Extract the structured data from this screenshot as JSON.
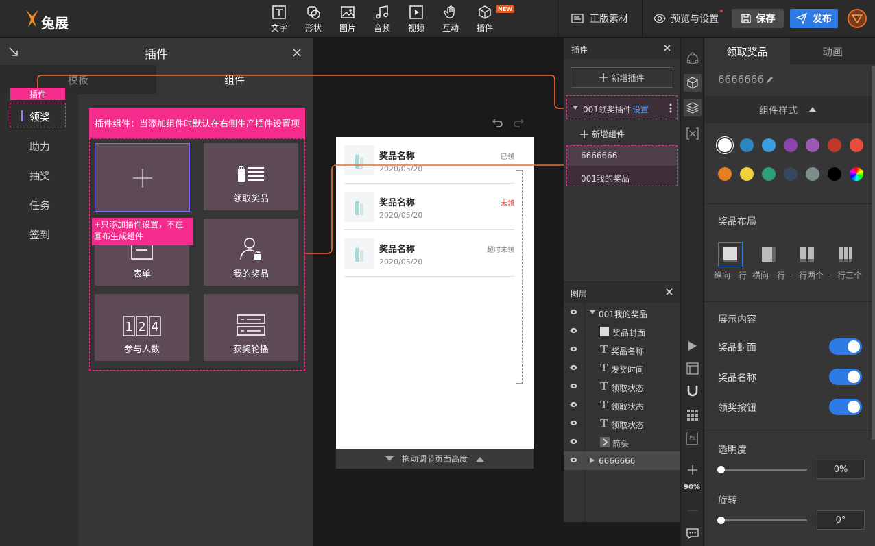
{
  "topbar": {
    "logo_text": "兔展",
    "tools": [
      {
        "label": "文字",
        "icon": "text-icon"
      },
      {
        "label": "形状",
        "icon": "shape-icon"
      },
      {
        "label": "图片",
        "icon": "image-icon"
      },
      {
        "label": "音频",
        "icon": "music-icon"
      },
      {
        "label": "视频",
        "icon": "video-icon"
      },
      {
        "label": "互动",
        "icon": "hand-icon"
      },
      {
        "label": "插件",
        "icon": "cube-icon"
      }
    ],
    "new_badge": "NEW",
    "assets_label": "正版素材",
    "preview_label": "预览与设置",
    "save_label": "保存",
    "publish_label": "发布"
  },
  "plugin_panel": {
    "title": "插件",
    "tabs": [
      "模板",
      "组件"
    ],
    "active_tab": "组件",
    "categories": [
      "领奖",
      "助力",
      "抽奖",
      "任务",
      "签到"
    ],
    "active_category": "领奖",
    "tag_label": "插件",
    "banner": "插件组件：当添加组件时默认在右侧生产插件设置项",
    "add_note": "+只添加插件设置，不在画布生成组件",
    "cards": [
      {
        "label": "领取奖品"
      },
      {
        "label": "表单"
      },
      {
        "label": "我的奖品"
      },
      {
        "label": "参与人数"
      },
      {
        "label": "获奖轮播"
      }
    ]
  },
  "canvas": {
    "prizes": [
      {
        "name": "奖品名称",
        "date": "2020/05/20",
        "status": "已领",
        "status_color": "#777777"
      },
      {
        "name": "奖品名称",
        "date": "2020/05/20",
        "status": "未领",
        "status_color": "#e02020"
      },
      {
        "name": "奖品名称",
        "date": "2020/05/20",
        "status": "超时未领",
        "status_color": "#777777"
      }
    ],
    "resize_label": "拖动调节页面高度"
  },
  "float_plugin": {
    "title": "插件",
    "add_plugin": "新增插件",
    "plugin_name": "001领奖插件",
    "settings_link": "设置",
    "add_component": "新增组件",
    "components": [
      "6666666",
      "001我的奖品"
    ]
  },
  "layers": {
    "title": "图层",
    "group": "001我的奖品",
    "items": [
      {
        "label": "奖品封面",
        "type": "image"
      },
      {
        "label": "奖品名称",
        "type": "text"
      },
      {
        "label": "发奖时间",
        "type": "text"
      },
      {
        "label": "领取状态",
        "type": "text"
      },
      {
        "label": "领取状态",
        "type": "text"
      },
      {
        "label": "领取状态",
        "type": "text"
      },
      {
        "label": "箭头",
        "type": "arrow"
      }
    ],
    "second_group": "6666666"
  },
  "vtools": {
    "zoom": "90%"
  },
  "props": {
    "tabs": [
      "领取奖品",
      "动画"
    ],
    "active_tab": "领取奖品",
    "component_name": "6666666",
    "style_title": "组件样式",
    "colors": [
      "#ffffff",
      "#2e86c1",
      "#3a9ee0",
      "#8e44ad",
      "#9b59b6",
      "#c0392b",
      "#e74c3c",
      "#e67e22",
      "#f4d03f",
      "#2e9e7d",
      "#34495e",
      "#7f8c8d",
      "#000000"
    ],
    "layout_title": "奖品布局",
    "layouts": [
      "纵向一行",
      "横向一行",
      "一行两个",
      "一行三个"
    ],
    "display_title": "展示内容",
    "toggles": [
      {
        "label": "奖品封面",
        "on": true
      },
      {
        "label": "奖品名称",
        "on": true
      },
      {
        "label": "领奖按钮",
        "on": true
      }
    ],
    "opacity_label": "透明度",
    "opacity_value": "0%",
    "rotate_label": "旋转",
    "rotate_value": "0°"
  }
}
